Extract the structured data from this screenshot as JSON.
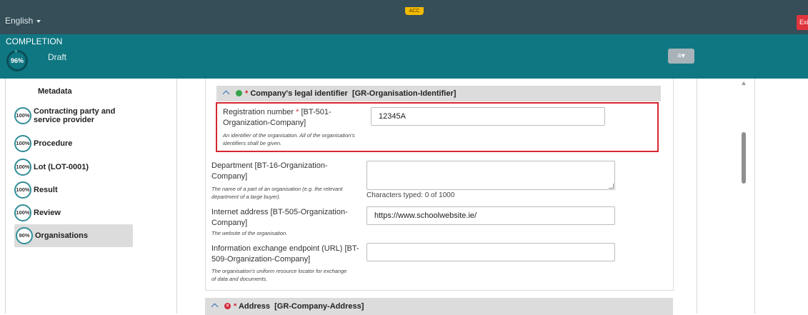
{
  "topbar": {
    "language": "English",
    "env_badge": "ACC",
    "exit_label": "Exit"
  },
  "completion": {
    "label": "COMPLETION",
    "percent": "96%",
    "status": "Draft"
  },
  "sidebar": {
    "items": [
      {
        "label": "Metadata",
        "percent": ""
      },
      {
        "label": "Contracting party and service provider",
        "percent": "100%"
      },
      {
        "label": "Procedure",
        "percent": "100%"
      },
      {
        "label": "Lot (LOT-0001)",
        "percent": "100%"
      },
      {
        "label": "Result",
        "percent": "100%"
      },
      {
        "label": "Review",
        "percent": "100%"
      },
      {
        "label": "Organisations",
        "percent": "90%"
      }
    ]
  },
  "form": {
    "section1": {
      "title": "Company's legal identifier",
      "code": "[GR-Organisation-Identifier]"
    },
    "registration": {
      "label_a": "Registration number",
      "label_b": "[BT-501-Organization-Company]",
      "help": "An identifier of the organisation. All of the organisation's identifiers shall be given.",
      "value": "12345A"
    },
    "department": {
      "label": "Department [BT-16-Organization-Company]",
      "help": "The name of a part of an organisation (e.g. the relevant department of a large buyer).",
      "value": "",
      "chars": "Characters typed: 0 of 1000"
    },
    "internet": {
      "label": "Internet address [BT-505-Organization-Company]",
      "help": "The website of the organisation.",
      "value": "https://www.schoolwebsite.ie/"
    },
    "endpoint": {
      "label": "Information exchange endpoint (URL) [BT-509-Organization-Company]",
      "help": "The organisation's uniform resource locator for exchange of data and documents.",
      "value": ""
    },
    "section2": {
      "title": "Address",
      "code": "[GR-Company-Address]"
    }
  },
  "colors": {
    "topbar": "#354e58",
    "band": "#0f7782",
    "error": "#d82630",
    "ok": "#38a34c"
  }
}
